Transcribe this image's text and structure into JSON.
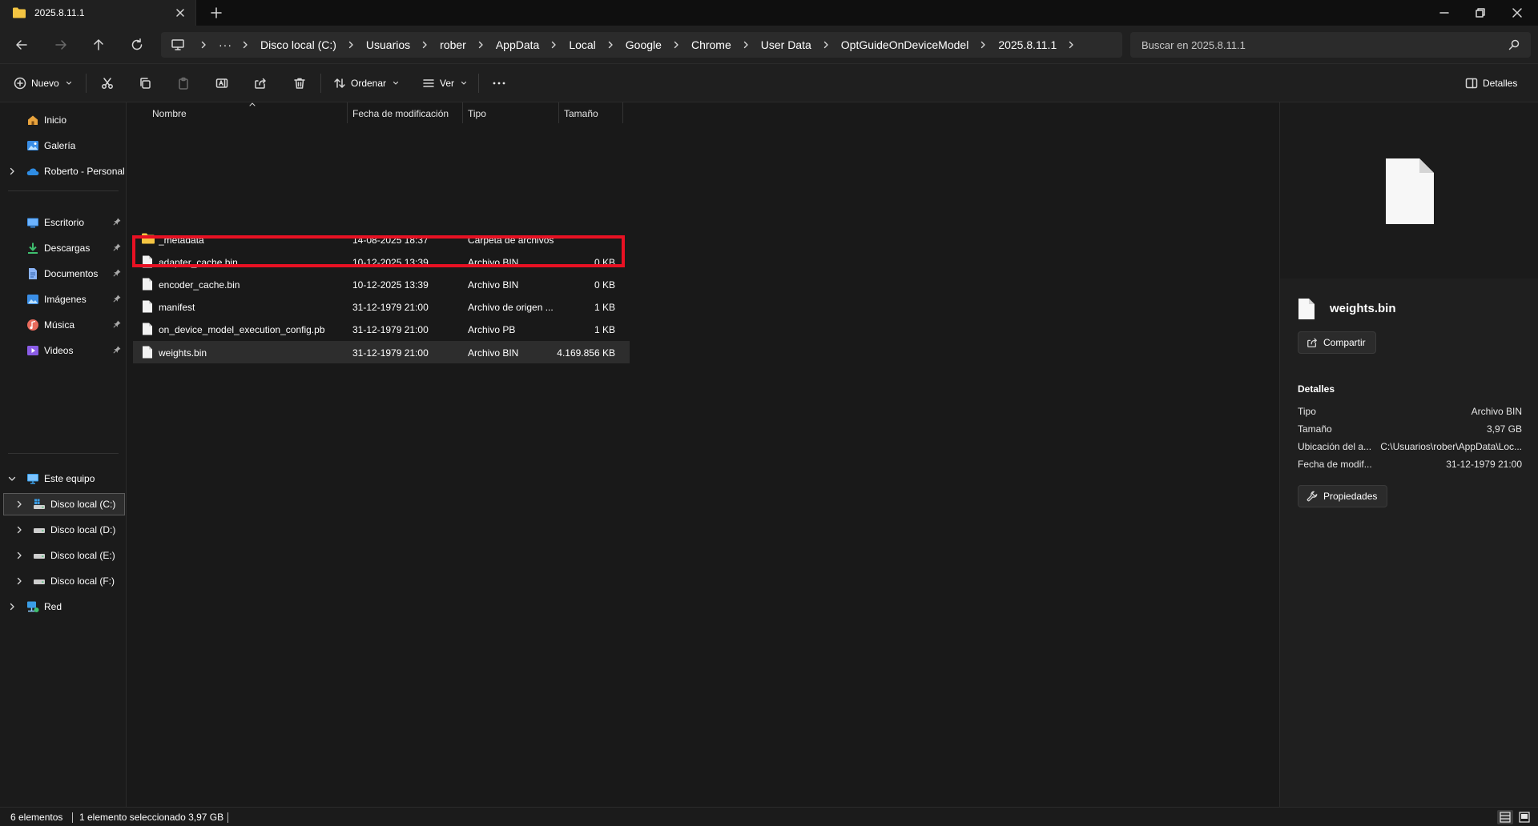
{
  "window": {
    "tab_title": "2025.8.11.1"
  },
  "breadcrumbs": [
    "Disco local (C:)",
    "Usuarios",
    "rober",
    "AppData",
    "Local",
    "Google",
    "Chrome",
    "User Data",
    "OptGuideOnDeviceModel",
    "2025.8.11.1"
  ],
  "search": {
    "placeholder": "Buscar en 2025.8.11.1"
  },
  "toolbar": {
    "new_label": "Nuevo",
    "sort_label": "Ordenar",
    "view_label": "Ver",
    "details_label": "Detalles"
  },
  "sidebar": {
    "quick": [
      {
        "label": "Inicio",
        "icon": "home-icon"
      },
      {
        "label": "Galería",
        "icon": "gallery-icon"
      },
      {
        "label": "Roberto - Personal",
        "icon": "onedrive-icon"
      }
    ],
    "pinned": [
      {
        "label": "Escritorio",
        "icon": "desktop-icon"
      },
      {
        "label": "Descargas",
        "icon": "downloads-icon"
      },
      {
        "label": "Documentos",
        "icon": "documents-icon"
      },
      {
        "label": "Imágenes",
        "icon": "pictures-icon"
      },
      {
        "label": "Música",
        "icon": "music-icon"
      },
      {
        "label": "Videos",
        "icon": "videos-icon"
      }
    ],
    "this_pc": "Este equipo",
    "drives": [
      "Disco local (C:)",
      "Disco local (D:)",
      "Disco local (E:)",
      "Disco local (F:)"
    ],
    "network": "Red"
  },
  "columns": {
    "name": "Nombre",
    "modified": "Fecha de modificación",
    "type": "Tipo",
    "size": "Tamaño"
  },
  "files": [
    {
      "name": "_metadata",
      "modified": "14-08-2025 18:37",
      "type": "Carpeta de archivos",
      "size": "",
      "icon": "folder-icon"
    },
    {
      "name": "adapter_cache.bin",
      "modified": "10-12-2025 13:39",
      "type": "Archivo BIN",
      "size": "0 KB",
      "icon": "file-icon"
    },
    {
      "name": "encoder_cache.bin",
      "modified": "10-12-2025 13:39",
      "type": "Archivo BIN",
      "size": "0 KB",
      "icon": "file-icon"
    },
    {
      "name": "manifest",
      "modified": "31-12-1979 21:00",
      "type": "Archivo de origen ...",
      "size": "1 KB",
      "icon": "file-icon"
    },
    {
      "name": "on_device_model_execution_config.pb",
      "modified": "31-12-1979 21:00",
      "type": "Archivo PB",
      "size": "1 KB",
      "icon": "file-icon"
    },
    {
      "name": "weights.bin",
      "modified": "31-12-1979 21:00",
      "type": "Archivo BIN",
      "size": "4.169.856 KB",
      "icon": "file-icon"
    }
  ],
  "details": {
    "file_name": "weights.bin",
    "share_label": "Compartir",
    "section_title": "Detalles",
    "props": [
      {
        "key": "Tipo",
        "value": "Archivo BIN"
      },
      {
        "key": "Tamaño",
        "value": "3,97 GB"
      },
      {
        "key": "Ubicación del a...",
        "value": "C:\\Usuarios\\rober\\AppData\\Loc..."
      },
      {
        "key": "Fecha de modif...",
        "value": "31-12-1979 21:00"
      }
    ],
    "properties_label": "Propiedades"
  },
  "status": {
    "count": "6 elementos",
    "selection": "1 elemento seleccionado  3,97 GB"
  },
  "colors": {
    "highlight": "#e81123",
    "folder": "#f4c542"
  }
}
